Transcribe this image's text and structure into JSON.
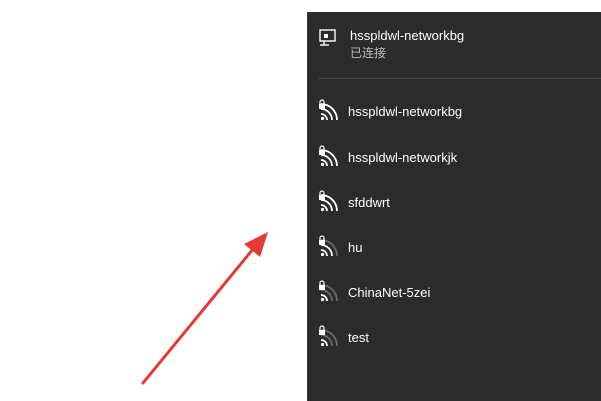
{
  "connected": {
    "name": "hsspldwl-networkbg",
    "status": "已连接",
    "icon": "ethernet-icon"
  },
  "networks": [
    {
      "name": "hsspldwl-networkbg",
      "icon": "wifi-secured-icon",
      "signal": 4
    },
    {
      "name": "hsspldwl-networkjk",
      "icon": "wifi-secured-icon",
      "signal": 4
    },
    {
      "name": "sfddwrt",
      "icon": "wifi-secured-icon",
      "signal": 4
    },
    {
      "name": "hu",
      "icon": "wifi-secured-icon",
      "signal": 3
    },
    {
      "name": "ChinaNet-5zei",
      "icon": "wifi-secured-icon",
      "signal": 2
    },
    {
      "name": "test",
      "icon": "wifi-secured-icon",
      "signal": 2
    }
  ],
  "colors": {
    "panel": "#2b2b2b",
    "text": "#ffffff",
    "subtext": "#bdbdbd",
    "signal_active": "#ffffff",
    "signal_inactive": "#6a6a6a",
    "arrow": "#e53935"
  }
}
